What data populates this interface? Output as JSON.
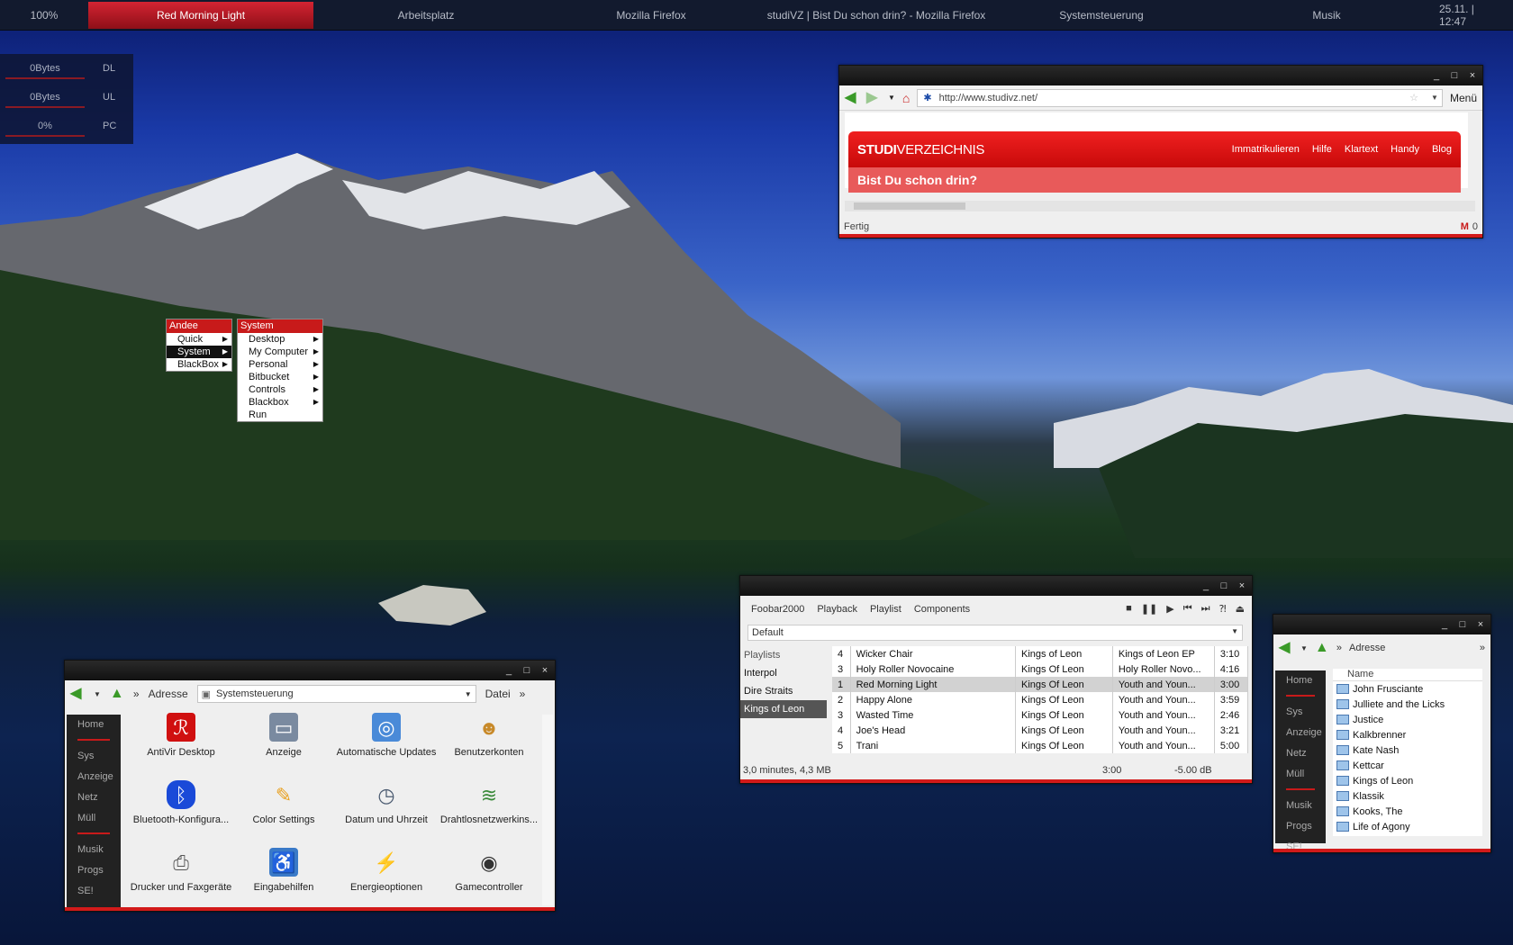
{
  "taskbar": {
    "cpu": "100%",
    "tasks": [
      "Red Morning Light",
      "Arbeitsplatz",
      "Mozilla Firefox",
      "studiVZ | Bist Du schon drin? - Mozilla Firefox",
      "Systemsteuerung",
      "Musik"
    ],
    "clock": "25.11. | 12:47"
  },
  "net": {
    "rows": [
      {
        "value": "0Bytes",
        "key": "DL"
      },
      {
        "value": "0Bytes",
        "key": "UL"
      },
      {
        "value": "0%",
        "key": "PC"
      }
    ]
  },
  "firefox": {
    "url": "http://www.studivz.net/",
    "menu": "Menü",
    "logo_bold": "STUDI",
    "logo_rest": "VERZEICHNIS",
    "nav": [
      "Immatrikulieren",
      "Hilfe",
      "Klartext",
      "Handy",
      "Blog"
    ],
    "subtitle": "Bist Du schon drin?",
    "status": "Fertig",
    "mail_count": "0"
  },
  "menus": {
    "main": {
      "title": "Andee",
      "items": [
        "Quick",
        "System",
        "BlackBox"
      ]
    },
    "system": {
      "title": "System",
      "items": [
        "Desktop",
        "My Computer",
        "Personal",
        "Bitbucket",
        "Controls",
        "Blackbox",
        "Run"
      ]
    }
  },
  "sidebar": [
    "Home",
    "Sys",
    "Anzeige",
    "Netz",
    "Müll",
    "Musik",
    "Progs",
    "SE!"
  ],
  "cp": {
    "address_label": "Adresse",
    "address": "Systemsteuerung",
    "datei": "Datei",
    "items": [
      {
        "label": "AntiVir Desktop",
        "icon": "antivir-icon"
      },
      {
        "label": "Anzeige",
        "icon": "display-icon"
      },
      {
        "label": "Automatische Updates",
        "icon": "updates-icon"
      },
      {
        "label": "Benutzerkonten",
        "icon": "users-icon"
      },
      {
        "label": "Bluetooth-Konfigura...",
        "icon": "bluetooth-icon"
      },
      {
        "label": "Color Settings",
        "icon": "color-icon"
      },
      {
        "label": "Datum und Uhrzeit",
        "icon": "clock-icon"
      },
      {
        "label": "Drahtlosnetzwerkins...",
        "icon": "wireless-icon"
      },
      {
        "label": "Drucker und Faxgeräte",
        "icon": "printer-icon"
      },
      {
        "label": "Eingabehilfen",
        "icon": "accessibility-icon"
      },
      {
        "label": "Energieoptionen",
        "icon": "power-icon"
      },
      {
        "label": "Gamecontroller",
        "icon": "gamepad-icon"
      }
    ]
  },
  "foobar": {
    "menu": [
      "Foobar2000",
      "Playback",
      "Playlist",
      "Components"
    ],
    "playlist_combo": "Default",
    "playlists_header": "Playlists",
    "playlists": [
      "Interpol",
      "Dire Straits",
      "Kings of Leon"
    ],
    "tracks": [
      [
        "4",
        "Wicker Chair",
        "Kings of Leon",
        "Kings of Leon EP",
        "3:10"
      ],
      [
        "3",
        "Holy Roller Novocaine",
        "Kings Of Leon",
        "Holy Roller Novo...",
        "4:16"
      ],
      [
        "1",
        "Red Morning Light",
        "Kings Of Leon",
        "Youth and Youn...",
        "3:00"
      ],
      [
        "2",
        "Happy Alone",
        "Kings Of Leon",
        "Youth and Youn...",
        "3:59"
      ],
      [
        "3",
        "Wasted Time",
        "Kings Of Leon",
        "Youth and Youn...",
        "2:46"
      ],
      [
        "4",
        "Joe's Head",
        "Kings Of Leon",
        "Youth and Youn...",
        "3:21"
      ],
      [
        "5",
        "Trani",
        "Kings Of Leon",
        "Youth and Youn...",
        "5:00"
      ]
    ],
    "status_left": "3,0 minutes, 4,3 MB",
    "status_time": "3:00",
    "status_db": "-5.00 dB"
  },
  "explorer": {
    "address_label": "Adresse",
    "name_header": "Name",
    "folders": [
      "John Frusciante",
      "Julliete and the Licks",
      "Justice",
      "Kalkbrenner",
      "Kate Nash",
      "Kettcar",
      "Kings of Leon",
      "Klassik",
      "Kooks, The",
      "Life of Agony"
    ]
  },
  "colors": {
    "accent": "#c81a1a",
    "panel": "#222222",
    "taskbar": "#121a2e"
  }
}
